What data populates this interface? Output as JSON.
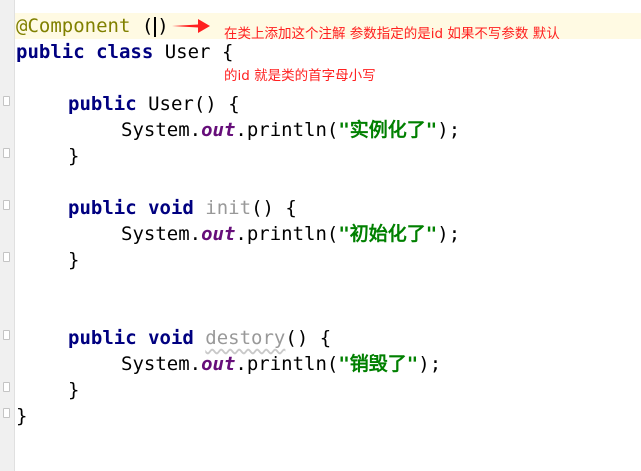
{
  "code": {
    "annotation": "@Component",
    "annotation_paren_open": "(",
    "annotation_paren_close": ")",
    "class_decl": {
      "kw": "public class",
      "name": "User",
      "brace": "{"
    },
    "constructor": {
      "kw": "public",
      "name": "User",
      "parens": "()",
      "brace": "{"
    },
    "init": {
      "kw": "public void",
      "name": "init",
      "parens": "()",
      "brace": "{"
    },
    "destroy": {
      "kw": "public void",
      "name": "destory",
      "parens": "()",
      "brace": "{"
    },
    "sys": "System.",
    "out": "out",
    "println_open": ".println(",
    "str_constructor": "\"实例化了\"",
    "str_init": "\"初始化了\"",
    "str_destroy": "\"销毁了\"",
    "stmt_end": ");",
    "close_brace": "}"
  },
  "annotations": {
    "note1": "在类上添加这个注解  参数指定的是id  如果不写参数 默认",
    "note2": "的id  就是类的首字母小写",
    "color": "#ff2020"
  },
  "colors": {
    "keyword": "#000080",
    "annotation": "#808000",
    "field": "#660e7a",
    "string": "#008000",
    "unused": "#999999",
    "current_line": "#fffae3"
  }
}
